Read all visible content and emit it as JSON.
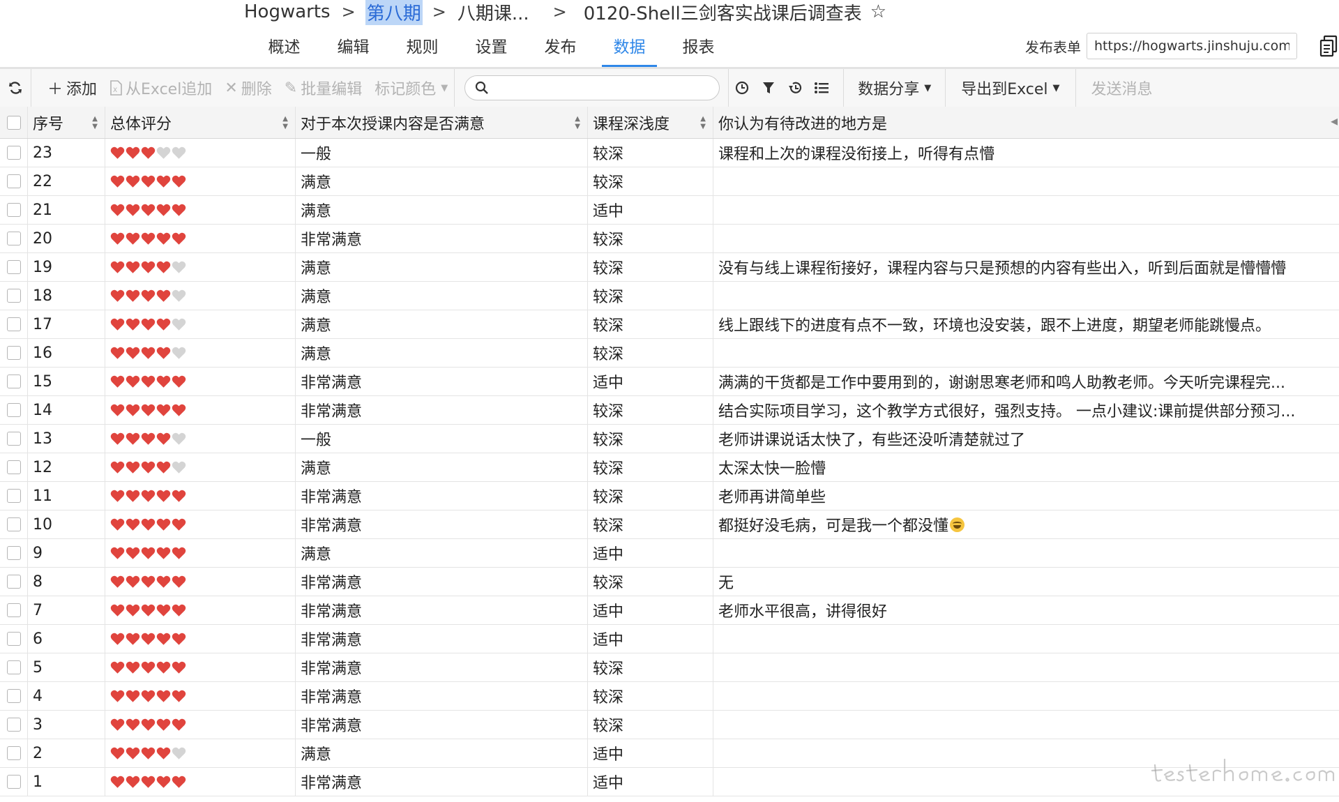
{
  "breadcrumb": {
    "items": [
      "Hogwarts",
      "第八期",
      "八期课...",
      "0120-Shell三剑客实战课后调查表"
    ],
    "selected_index": 1
  },
  "nav": {
    "tabs": [
      "概述",
      "编辑",
      "规则",
      "设置",
      "发布",
      "数据",
      "报表"
    ],
    "active_index": 5
  },
  "publish": {
    "label": "发布表单",
    "url": "https://hogwarts.jinshuju.com"
  },
  "toolbar": {
    "add_label": "添加",
    "excel_append_label": "从Excel追加",
    "delete_label": "删除",
    "batch_edit_label": "批量编辑",
    "mark_color_label": "标记颜色",
    "search_placeholder": "",
    "data_share_label": "数据分享",
    "export_excel_label": "导出到Excel",
    "send_message_label": "发送消息"
  },
  "table": {
    "columns": [
      "序号",
      "总体评分",
      "对于本次授课内容是否满意",
      "课程深浅度",
      "你认为有待改进的地方是"
    ],
    "max_rating": 5,
    "rows": [
      {
        "seq": "23",
        "rating": 3,
        "satisfaction": "一般",
        "depth": "较深",
        "improve": "课程和上次的课程没衔接上，听得有点懵"
      },
      {
        "seq": "22",
        "rating": 5,
        "satisfaction": "满意",
        "depth": "较深",
        "improve": ""
      },
      {
        "seq": "21",
        "rating": 5,
        "satisfaction": "满意",
        "depth": "适中",
        "improve": ""
      },
      {
        "seq": "20",
        "rating": 5,
        "satisfaction": "非常满意",
        "depth": "较深",
        "improve": ""
      },
      {
        "seq": "19",
        "rating": 4,
        "satisfaction": "满意",
        "depth": "较深",
        "improve": "没有与线上课程衔接好，课程内容与只是预想的内容有些出入，听到后面就是懵懵懵"
      },
      {
        "seq": "18",
        "rating": 4,
        "satisfaction": "满意",
        "depth": "较深",
        "improve": ""
      },
      {
        "seq": "17",
        "rating": 4,
        "satisfaction": "满意",
        "depth": "较深",
        "improve": "线上跟线下的进度有点不一致，环境也没安装，跟不上进度，期望老师能跳慢点。"
      },
      {
        "seq": "16",
        "rating": 4,
        "satisfaction": "满意",
        "depth": "较深",
        "improve": ""
      },
      {
        "seq": "15",
        "rating": 5,
        "satisfaction": "非常满意",
        "depth": "适中",
        "improve": "满满的干货都是工作中要用到的，谢谢思寒老师和鸣人助教老师。今天听完课程完..."
      },
      {
        "seq": "14",
        "rating": 5,
        "satisfaction": "非常满意",
        "depth": "较深",
        "improve": "结合实际项目学习，这个教学方式很好，强烈支持。 一点小建议:课前提供部分预习..."
      },
      {
        "seq": "13",
        "rating": 4,
        "satisfaction": "一般",
        "depth": "较深",
        "improve": "老师讲课说话太快了，有些还没听清楚就过了"
      },
      {
        "seq": "12",
        "rating": 4,
        "satisfaction": "满意",
        "depth": "较深",
        "improve": "太深太快一脸懵"
      },
      {
        "seq": "11",
        "rating": 5,
        "satisfaction": "非常满意",
        "depth": "较深",
        "improve": "老师再讲简单些"
      },
      {
        "seq": "10",
        "rating": 5,
        "satisfaction": "非常满意",
        "depth": "较深",
        "improve": "都挺好没毛病，可是我一个都没懂",
        "emoji": "grinning-face"
      },
      {
        "seq": "9",
        "rating": 5,
        "satisfaction": "满意",
        "depth": "适中",
        "improve": ""
      },
      {
        "seq": "8",
        "rating": 5,
        "satisfaction": "非常满意",
        "depth": "较深",
        "improve": "无"
      },
      {
        "seq": "7",
        "rating": 5,
        "satisfaction": "非常满意",
        "depth": "适中",
        "improve": "老师水平很高，讲得很好"
      },
      {
        "seq": "6",
        "rating": 5,
        "satisfaction": "非常满意",
        "depth": "适中",
        "improve": ""
      },
      {
        "seq": "5",
        "rating": 5,
        "satisfaction": "非常满意",
        "depth": "较深",
        "improve": ""
      },
      {
        "seq": "4",
        "rating": 5,
        "satisfaction": "非常满意",
        "depth": "较深",
        "improve": ""
      },
      {
        "seq": "3",
        "rating": 5,
        "satisfaction": "非常满意",
        "depth": "较深",
        "improve": ""
      },
      {
        "seq": "2",
        "rating": 4,
        "satisfaction": "满意",
        "depth": "适中",
        "improve": ""
      },
      {
        "seq": "1",
        "rating": 5,
        "satisfaction": "非常满意",
        "depth": "适中",
        "improve": ""
      }
    ]
  },
  "colors": {
    "accent": "#2f87e8",
    "heart_filled": "#e0443d",
    "heart_empty": "#d4d4d4",
    "selection": "#bcd6f7"
  },
  "watermark": "testerhome.com"
}
